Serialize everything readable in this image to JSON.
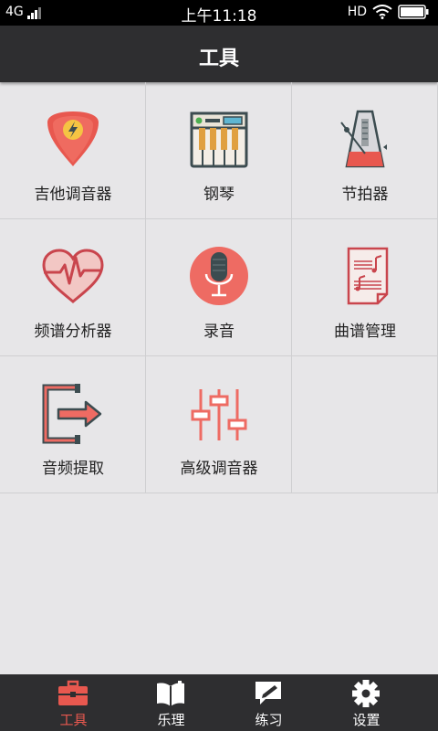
{
  "status_bar": {
    "network": "4G",
    "time": "上午11:18",
    "hd": "HD"
  },
  "header": {
    "title": "工具"
  },
  "tools": [
    {
      "label": "吉他调音器",
      "icon": "guitar-pick-icon"
    },
    {
      "label": "钢琴",
      "icon": "piano-icon"
    },
    {
      "label": "节拍器",
      "icon": "metronome-icon"
    },
    {
      "label": "频谱分析器",
      "icon": "heart-spectrum-icon"
    },
    {
      "label": "录音",
      "icon": "microphone-icon"
    },
    {
      "label": "曲谱管理",
      "icon": "sheet-music-icon"
    },
    {
      "label": "音频提取",
      "icon": "audio-extract-icon"
    },
    {
      "label": "高级调音器",
      "icon": "equalizer-sliders-icon"
    }
  ],
  "tab_bar": {
    "items": [
      {
        "label": "工具",
        "icon": "toolbox-icon",
        "active": true
      },
      {
        "label": "乐理",
        "icon": "open-book-icon",
        "active": false
      },
      {
        "label": "练习",
        "icon": "pencil-chat-icon",
        "active": false
      },
      {
        "label": "设置",
        "icon": "gear-icon",
        "active": false
      }
    ]
  },
  "colors": {
    "accent": "#e8584f",
    "header_bg": "#2e2e30",
    "page_bg": "#e7e6e8",
    "icon_dark": "#3c4c50"
  }
}
